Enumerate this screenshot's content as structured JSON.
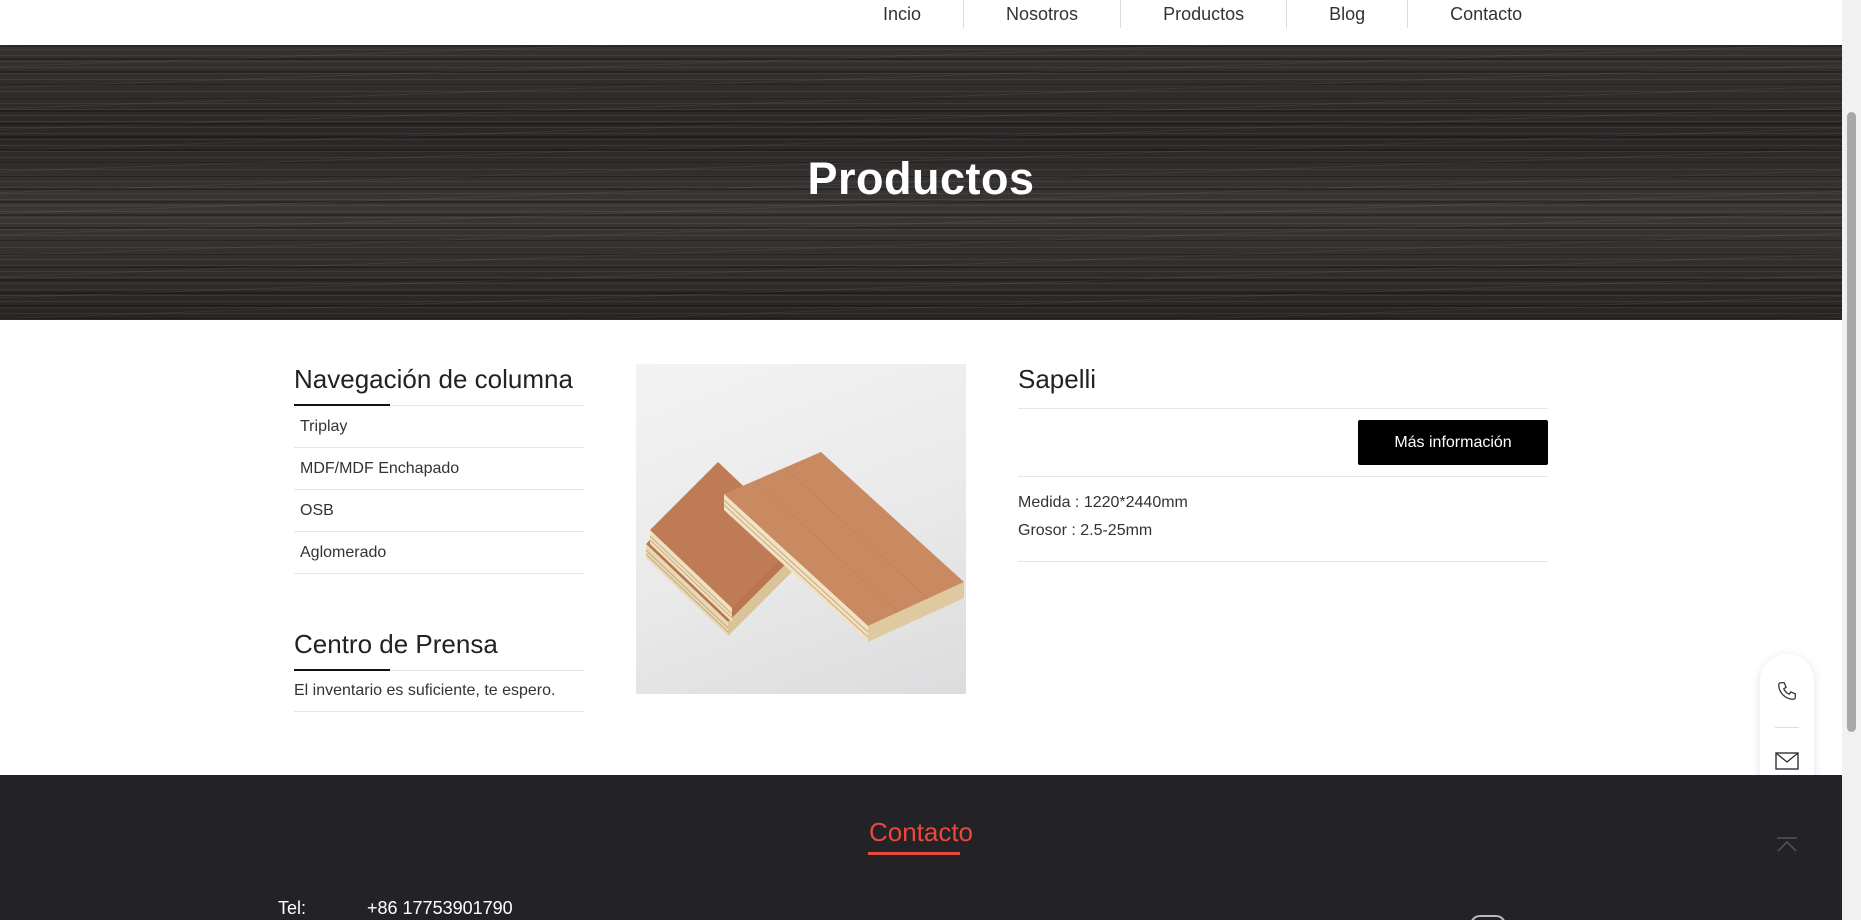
{
  "nav": {
    "items": [
      {
        "label": "Incio"
      },
      {
        "label": "Nosotros"
      },
      {
        "label": "Productos"
      },
      {
        "label": "Blog"
      },
      {
        "label": "Contacto"
      }
    ]
  },
  "hero": {
    "title": "Productos"
  },
  "sidebar": {
    "nav_title": "Navegación de columna",
    "items": [
      {
        "label": "Triplay"
      },
      {
        "label": "MDF/MDF Enchapado"
      },
      {
        "label": "OSB"
      },
      {
        "label": "Aglomerado"
      }
    ],
    "press_title": "Centro de Prensa",
    "press_text": "El inventario es suficiente, te espero."
  },
  "product": {
    "name": "Sapelli",
    "more_button": "Más información",
    "specs": [
      {
        "text": "Medida : 1220*2440mm"
      },
      {
        "text": "Grosor : 2.5-25mm"
      }
    ]
  },
  "floating": {
    "icons": [
      "phone-icon",
      "mail-icon",
      "back-to-top-icon"
    ]
  },
  "footer": {
    "title": "Contacto",
    "tel_label": "Tel:",
    "tel_value": "+86 17753901790"
  },
  "colors": {
    "accent": "#e8493a",
    "footer_bg": "#232227",
    "button_bg": "#000000"
  }
}
